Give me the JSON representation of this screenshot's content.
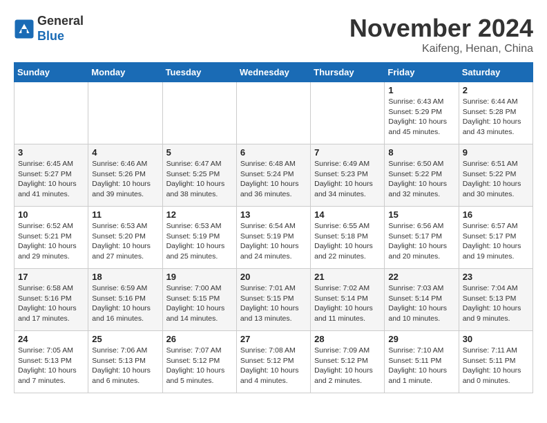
{
  "header": {
    "logo_line1": "General",
    "logo_line2": "Blue",
    "month_title": "November 2024",
    "location": "Kaifeng, Henan, China"
  },
  "weekdays": [
    "Sunday",
    "Monday",
    "Tuesday",
    "Wednesday",
    "Thursday",
    "Friday",
    "Saturday"
  ],
  "weeks": [
    [
      {
        "day": "",
        "info": ""
      },
      {
        "day": "",
        "info": ""
      },
      {
        "day": "",
        "info": ""
      },
      {
        "day": "",
        "info": ""
      },
      {
        "day": "",
        "info": ""
      },
      {
        "day": "1",
        "info": "Sunrise: 6:43 AM\nSunset: 5:29 PM\nDaylight: 10 hours\nand 45 minutes."
      },
      {
        "day": "2",
        "info": "Sunrise: 6:44 AM\nSunset: 5:28 PM\nDaylight: 10 hours\nand 43 minutes."
      }
    ],
    [
      {
        "day": "3",
        "info": "Sunrise: 6:45 AM\nSunset: 5:27 PM\nDaylight: 10 hours\nand 41 minutes."
      },
      {
        "day": "4",
        "info": "Sunrise: 6:46 AM\nSunset: 5:26 PM\nDaylight: 10 hours\nand 39 minutes."
      },
      {
        "day": "5",
        "info": "Sunrise: 6:47 AM\nSunset: 5:25 PM\nDaylight: 10 hours\nand 38 minutes."
      },
      {
        "day": "6",
        "info": "Sunrise: 6:48 AM\nSunset: 5:24 PM\nDaylight: 10 hours\nand 36 minutes."
      },
      {
        "day": "7",
        "info": "Sunrise: 6:49 AM\nSunset: 5:23 PM\nDaylight: 10 hours\nand 34 minutes."
      },
      {
        "day": "8",
        "info": "Sunrise: 6:50 AM\nSunset: 5:22 PM\nDaylight: 10 hours\nand 32 minutes."
      },
      {
        "day": "9",
        "info": "Sunrise: 6:51 AM\nSunset: 5:22 PM\nDaylight: 10 hours\nand 30 minutes."
      }
    ],
    [
      {
        "day": "10",
        "info": "Sunrise: 6:52 AM\nSunset: 5:21 PM\nDaylight: 10 hours\nand 29 minutes."
      },
      {
        "day": "11",
        "info": "Sunrise: 6:53 AM\nSunset: 5:20 PM\nDaylight: 10 hours\nand 27 minutes."
      },
      {
        "day": "12",
        "info": "Sunrise: 6:53 AM\nSunset: 5:19 PM\nDaylight: 10 hours\nand 25 minutes."
      },
      {
        "day": "13",
        "info": "Sunrise: 6:54 AM\nSunset: 5:19 PM\nDaylight: 10 hours\nand 24 minutes."
      },
      {
        "day": "14",
        "info": "Sunrise: 6:55 AM\nSunset: 5:18 PM\nDaylight: 10 hours\nand 22 minutes."
      },
      {
        "day": "15",
        "info": "Sunrise: 6:56 AM\nSunset: 5:17 PM\nDaylight: 10 hours\nand 20 minutes."
      },
      {
        "day": "16",
        "info": "Sunrise: 6:57 AM\nSunset: 5:17 PM\nDaylight: 10 hours\nand 19 minutes."
      }
    ],
    [
      {
        "day": "17",
        "info": "Sunrise: 6:58 AM\nSunset: 5:16 PM\nDaylight: 10 hours\nand 17 minutes."
      },
      {
        "day": "18",
        "info": "Sunrise: 6:59 AM\nSunset: 5:16 PM\nDaylight: 10 hours\nand 16 minutes."
      },
      {
        "day": "19",
        "info": "Sunrise: 7:00 AM\nSunset: 5:15 PM\nDaylight: 10 hours\nand 14 minutes."
      },
      {
        "day": "20",
        "info": "Sunrise: 7:01 AM\nSunset: 5:15 PM\nDaylight: 10 hours\nand 13 minutes."
      },
      {
        "day": "21",
        "info": "Sunrise: 7:02 AM\nSunset: 5:14 PM\nDaylight: 10 hours\nand 11 minutes."
      },
      {
        "day": "22",
        "info": "Sunrise: 7:03 AM\nSunset: 5:14 PM\nDaylight: 10 hours\nand 10 minutes."
      },
      {
        "day": "23",
        "info": "Sunrise: 7:04 AM\nSunset: 5:13 PM\nDaylight: 10 hours\nand 9 minutes."
      }
    ],
    [
      {
        "day": "24",
        "info": "Sunrise: 7:05 AM\nSunset: 5:13 PM\nDaylight: 10 hours\nand 7 minutes."
      },
      {
        "day": "25",
        "info": "Sunrise: 7:06 AM\nSunset: 5:13 PM\nDaylight: 10 hours\nand 6 minutes."
      },
      {
        "day": "26",
        "info": "Sunrise: 7:07 AM\nSunset: 5:12 PM\nDaylight: 10 hours\nand 5 minutes."
      },
      {
        "day": "27",
        "info": "Sunrise: 7:08 AM\nSunset: 5:12 PM\nDaylight: 10 hours\nand 4 minutes."
      },
      {
        "day": "28",
        "info": "Sunrise: 7:09 AM\nSunset: 5:12 PM\nDaylight: 10 hours\nand 2 minutes."
      },
      {
        "day": "29",
        "info": "Sunrise: 7:10 AM\nSunset: 5:11 PM\nDaylight: 10 hours\nand 1 minute."
      },
      {
        "day": "30",
        "info": "Sunrise: 7:11 AM\nSunset: 5:11 PM\nDaylight: 10 hours\nand 0 minutes."
      }
    ]
  ]
}
